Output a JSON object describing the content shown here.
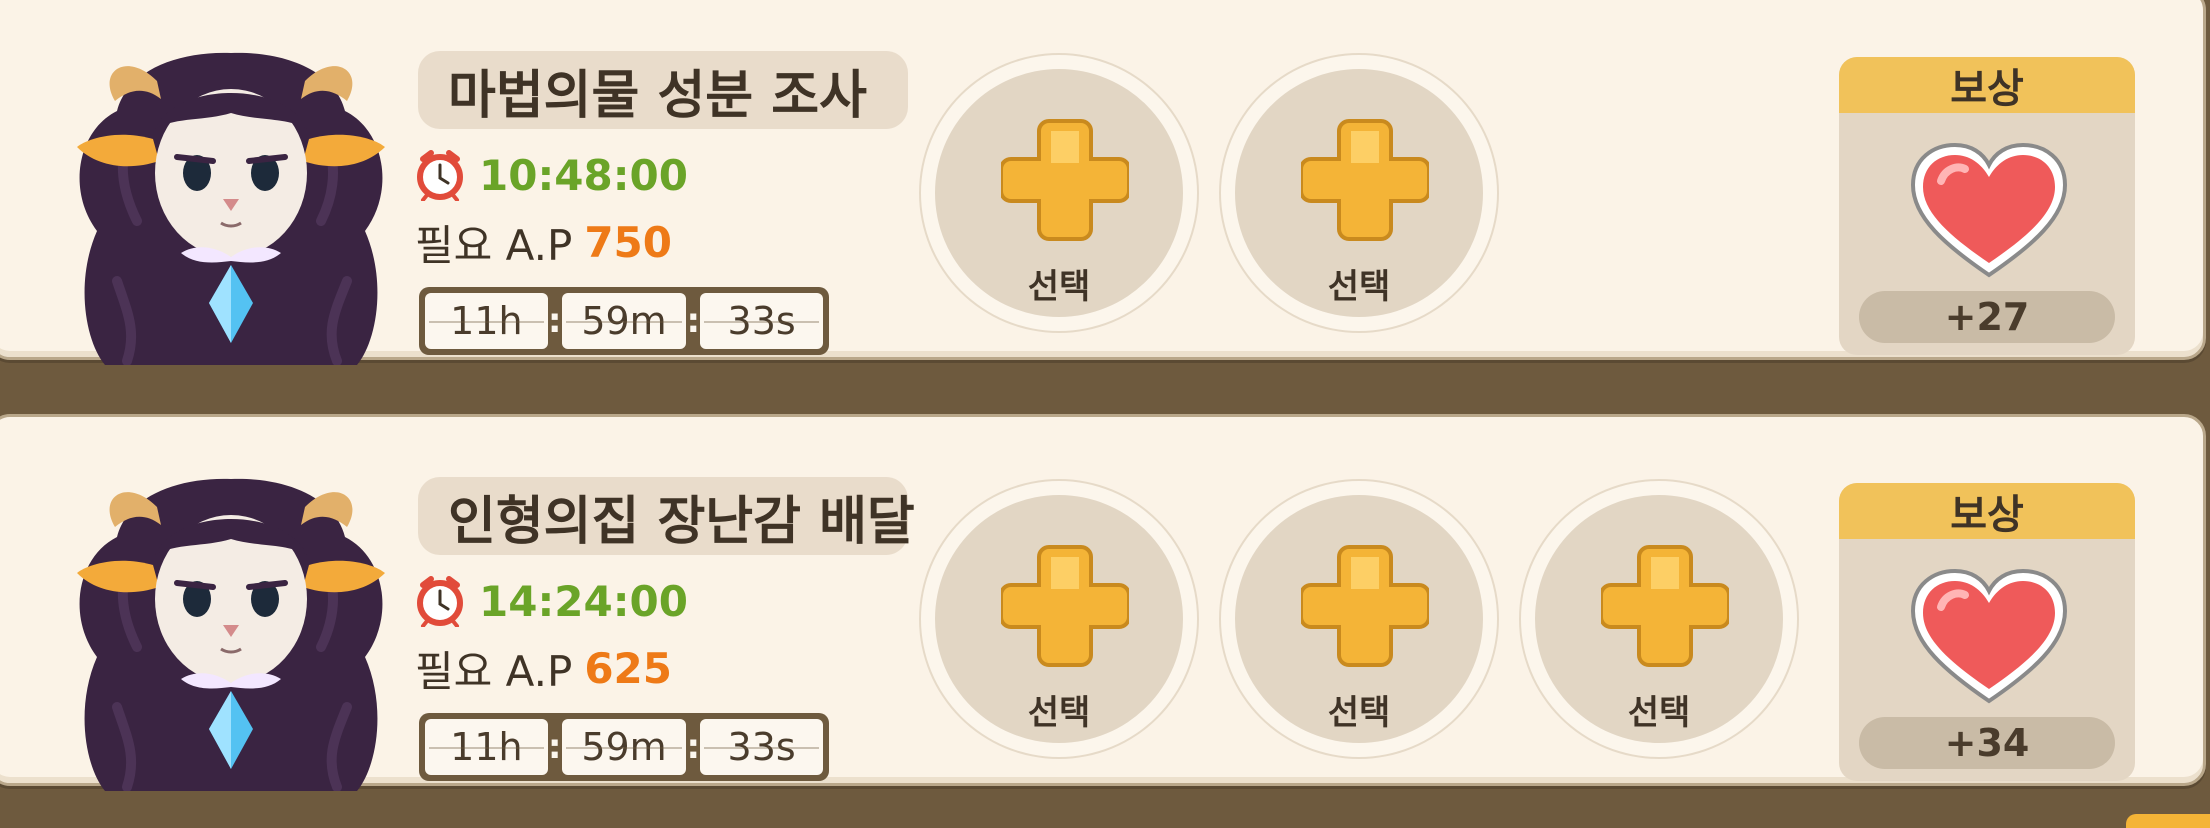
{
  "quests": [
    {
      "title": "마법의물 성분 조사",
      "time": "10:48:00",
      "ap_label": "필요 A.P",
      "ap_value": "750",
      "countdown": {
        "hours": "11h",
        "minutes": "59m",
        "seconds": "33s"
      },
      "slots": [
        "선택",
        "선택"
      ],
      "reward": {
        "header": "보상",
        "amount": "+27",
        "icon": "heart-icon"
      }
    },
    {
      "title": "인형의집 장난감 배달",
      "time": "14:24:00",
      "ap_label": "필요 A.P",
      "ap_value": "625",
      "countdown": {
        "hours": "11h",
        "minutes": "59m",
        "seconds": "33s"
      },
      "slots": [
        "선택",
        "선택",
        "선택"
      ],
      "reward": {
        "header": "보상",
        "amount": "+34",
        "icon": "heart-icon"
      }
    }
  ],
  "colors": {
    "timer": "#6aa428",
    "ap_value": "#ee7a17",
    "reward_header": "#f1c25a",
    "plus": "#f4b437",
    "card_bg": "#fbf3e7",
    "frame": "#6e5a3e"
  }
}
